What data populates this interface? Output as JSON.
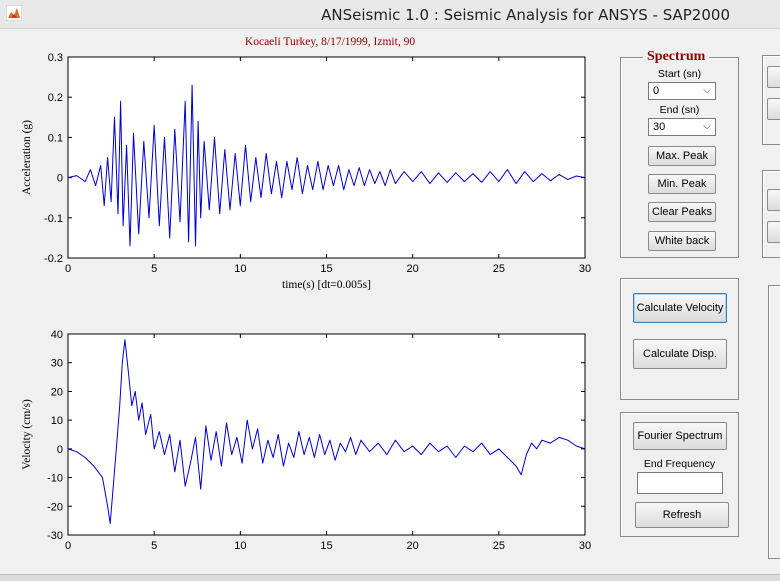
{
  "window": {
    "title": "ANSeismic 1.0 : Seismic Analysis for ANSYS - SAP2000"
  },
  "plot_title": "Kocaeli Turkey, 8/17/1999, Izmit, 90",
  "spectrum": {
    "title": "Spectrum",
    "start_label": "Start (sn)",
    "start_value": "0",
    "end_label": "End (sn)",
    "end_value": "30",
    "max_peak": "Max. Peak",
    "min_peak": "Min. Peak",
    "clear_peaks": "Clear Peaks",
    "white_back": "White back"
  },
  "calc": {
    "velocity": "Calculate Velocity",
    "disp": "Calculate Disp."
  },
  "fourier": {
    "button": "Fourier Spectrum",
    "end_freq_label": "End Frequency",
    "end_freq_value": "",
    "refresh": "Refresh"
  },
  "chart_data": [
    {
      "type": "line",
      "title": "Kocaeli Turkey, 8/17/1999, Izmit, 90",
      "xlabel": "time(s) [dt=0.005s]",
      "ylabel": "Acceleration (g)",
      "xlim": [
        0,
        30
      ],
      "ylim": [
        -0.2,
        0.3
      ],
      "xticks": [
        "0",
        "5",
        "10",
        "15",
        "20",
        "25",
        "30"
      ],
      "yticks": [
        "-0.2",
        "-0.1",
        "0",
        "0.1",
        "0.2",
        "0.3"
      ],
      "grid": false,
      "color": "#0000cc",
      "series": [
        {
          "x": [
            0,
            0.5,
            1,
            1.3,
            1.6,
            1.9,
            2.1,
            2.3,
            2.5,
            2.7,
            2.9,
            3.05,
            3.2,
            3.4,
            3.6,
            3.8,
            4.1,
            4.4,
            4.7,
            5,
            5.3,
            5.6,
            5.9,
            6.2,
            6.5,
            6.8,
            7,
            7.2,
            7.4,
            7.55,
            7.7,
            7.9,
            8.2,
            8.5,
            8.8,
            9.1,
            9.4,
            9.7,
            10,
            10.3,
            10.6,
            10.9,
            11.2,
            11.5,
            11.8,
            12.1,
            12.4,
            12.7,
            13,
            13.3,
            13.6,
            13.9,
            14.2,
            14.5,
            14.8,
            15.1,
            15.4,
            15.7,
            16,
            16.3,
            16.6,
            16.9,
            17.2,
            17.5,
            17.8,
            18.1,
            18.4,
            18.7,
            19,
            19.5,
            20,
            20.5,
            21,
            21.5,
            22,
            22.5,
            23,
            23.5,
            24,
            24.5,
            25,
            25.5,
            26,
            26.5,
            27,
            27.5,
            28,
            28.5,
            29,
            29.5,
            30
          ],
          "y": [
            0,
            0.005,
            -0.01,
            0.02,
            -0.02,
            0.03,
            -0.07,
            0.05,
            -0.06,
            0.15,
            -0.09,
            0.19,
            -0.12,
            0.08,
            -0.17,
            0.11,
            -0.14,
            0.09,
            -0.1,
            0.13,
            -0.12,
            0.1,
            -0.15,
            0.12,
            -0.11,
            0.19,
            -0.16,
            0.23,
            -0.17,
            0.14,
            -0.1,
            0.09,
            -0.08,
            0.1,
            -0.09,
            0.07,
            -0.08,
            0.06,
            -0.07,
            0.08,
            -0.06,
            0.05,
            -0.05,
            0.06,
            -0.04,
            0.04,
            -0.05,
            0.04,
            -0.03,
            0.05,
            -0.04,
            0.03,
            -0.03,
            0.04,
            -0.03,
            0.03,
            -0.02,
            0.03,
            -0.03,
            0.02,
            -0.02,
            0.025,
            -0.02,
            0.02,
            -0.015,
            0.015,
            -0.02,
            0.02,
            -0.015,
            0.015,
            -0.01,
            0.015,
            -0.015,
            0.012,
            -0.012,
            0.012,
            -0.01,
            0.01,
            -0.012,
            0.015,
            -0.01,
            0.02,
            -0.015,
            0.015,
            -0.01,
            0.01,
            -0.008,
            0.008,
            -0.005,
            0.004,
            0
          ]
        }
      ]
    },
    {
      "type": "line",
      "ylabel": "Velocity (cm/s)",
      "xlim": [
        0,
        30
      ],
      "ylim": [
        -30,
        40
      ],
      "xticks": [
        "0",
        "5",
        "10",
        "15",
        "20",
        "25",
        "30"
      ],
      "yticks": [
        "-30",
        "-20",
        "-10",
        "0",
        "10",
        "20",
        "30",
        "40"
      ],
      "grid": false,
      "color": "#0000cc",
      "series": [
        {
          "x": [
            0,
            0.5,
            1,
            1.5,
            2,
            2.3,
            2.45,
            2.6,
            2.8,
            3,
            3.15,
            3.3,
            3.5,
            3.7,
            3.9,
            4.1,
            4.3,
            4.5,
            4.8,
            5,
            5.3,
            5.6,
            5.9,
            6.2,
            6.5,
            6.8,
            7.1,
            7.4,
            7.7,
            8,
            8.3,
            8.6,
            8.9,
            9.2,
            9.5,
            9.8,
            10.1,
            10.4,
            10.7,
            11,
            11.3,
            11.6,
            11.9,
            12.2,
            12.5,
            12.8,
            13.1,
            13.4,
            13.7,
            14,
            14.3,
            14.6,
            14.9,
            15.2,
            15.5,
            15.8,
            16.1,
            16.4,
            16.7,
            17,
            17.5,
            18,
            18.5,
            19,
            19.5,
            20,
            20.5,
            21,
            21.5,
            22,
            22.5,
            23,
            23.5,
            24,
            24.5,
            25,
            25.5,
            26,
            26.3,
            26.6,
            26.9,
            27.2,
            27.5,
            28,
            28.5,
            29,
            29.5,
            30
          ],
          "y": [
            0,
            -1,
            -3,
            -6,
            -10,
            -20,
            -26,
            -15,
            0,
            15,
            30,
            38,
            27,
            15,
            20,
            10,
            16,
            5,
            12,
            0,
            6,
            -2,
            5,
            -8,
            3,
            -13,
            -5,
            4,
            -14,
            8,
            -4,
            6,
            -6,
            9,
            -2,
            4,
            -5,
            10,
            0,
            7,
            -5,
            3,
            -3,
            5,
            -6,
            2,
            -3,
            6,
            -2,
            4,
            -3,
            5,
            -2,
            3,
            -4,
            2,
            -1,
            4,
            -2,
            3,
            -1,
            2,
            -2,
            3,
            -1,
            1,
            -2,
            2,
            -1,
            1,
            -3,
            1,
            -1,
            2,
            -2,
            0,
            -3,
            -6,
            -9,
            -2,
            2,
            0,
            3,
            2,
            4,
            3,
            1,
            0
          ]
        }
      ]
    }
  ]
}
